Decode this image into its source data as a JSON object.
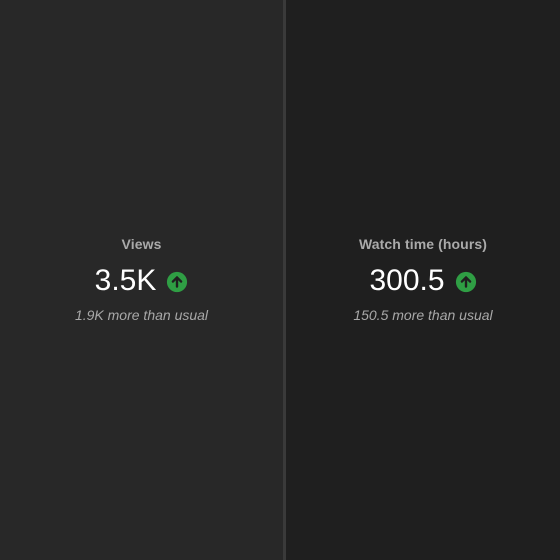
{
  "colors": {
    "background_left": "#282828",
    "background_right": "#1f1f1f",
    "divider": "#3a3a3a",
    "label": "#aaaaaa",
    "value": "#ffffff",
    "note": "#a8a8a8",
    "trend_up": "#2f9e44"
  },
  "metrics": [
    {
      "label": "Views",
      "value": "3.5K",
      "trend_icon": "arrow-up-circle-icon",
      "note": "1.9K more than usual"
    },
    {
      "label": "Watch time (hours)",
      "value": "300.5",
      "trend_icon": "arrow-up-circle-icon",
      "note": "150.5 more than usual"
    }
  ]
}
